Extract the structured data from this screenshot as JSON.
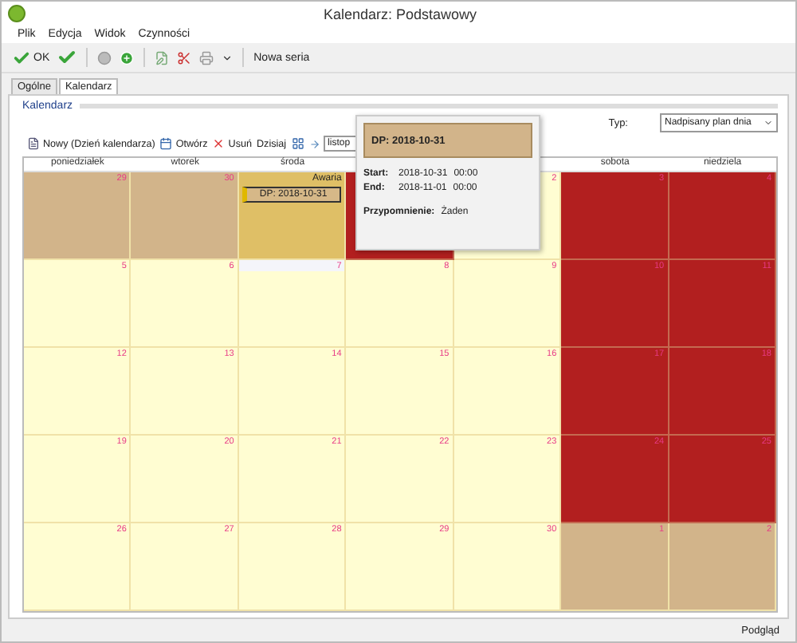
{
  "window": {
    "title": "Kalendarz: Podstawowy"
  },
  "menu": [
    "Plik",
    "Edycja",
    "Widok",
    "Czynności"
  ],
  "toolbar": [
    {
      "kind": "ok",
      "label": "OK"
    },
    {
      "kind": "check"
    },
    {
      "kind": "sep"
    },
    {
      "kind": "stop"
    },
    {
      "kind": "add"
    },
    {
      "kind": "sep"
    },
    {
      "kind": "edit"
    },
    {
      "kind": "tools"
    },
    {
      "kind": "print"
    },
    {
      "kind": "caret"
    },
    {
      "kind": "sep"
    },
    {
      "kind": "text",
      "label": "Nowa seria"
    }
  ],
  "tabs": [
    {
      "label": "Ogólne",
      "selected": false
    },
    {
      "label": "Kalendarz",
      "selected": true
    }
  ],
  "group_title": "Kalendarz",
  "type_label": "Typ:",
  "type_value": "Nadpisany plan dnia",
  "actions": [
    {
      "kind": "new",
      "label": "Nowy (Dzień kalendarza)"
    },
    {
      "kind": "open",
      "label": "Otwórz"
    },
    {
      "kind": "delete",
      "label": "Usuń"
    },
    {
      "kind": "today",
      "label": "Dzisiaj"
    },
    {
      "kind": "view"
    },
    {
      "kind": "arrow"
    }
  ],
  "month_field": "listop",
  "day_headers_left": [
    "poniedziałek",
    "wtorek",
    "środa"
  ],
  "day_headers_right": [
    "sobota",
    "niedziela"
  ],
  "weeks": [
    {
      "days": [
        {
          "n": "29",
          "kind": "past"
        },
        {
          "n": "30",
          "kind": "past"
        },
        {
          "kind": "selected",
          "note": "Awaria",
          "event": "DP: 2018-10-31"
        },
        {
          "kind": "free"
        },
        {
          "n": "2",
          "kind": "work"
        },
        {
          "n": "3",
          "kind": "free"
        },
        {
          "n": "4",
          "kind": "free"
        }
      ]
    },
    {
      "days": [
        {
          "n": "5",
          "kind": "work"
        },
        {
          "n": "6",
          "kind": "work"
        },
        {
          "n": "7",
          "kind": "work",
          "today": true
        },
        {
          "n": "8",
          "kind": "work"
        },
        {
          "n": "9",
          "kind": "work"
        },
        {
          "n": "10",
          "kind": "free"
        },
        {
          "n": "11",
          "kind": "free"
        }
      ]
    },
    {
      "days": [
        {
          "n": "12",
          "kind": "work"
        },
        {
          "n": "13",
          "kind": "work"
        },
        {
          "n": "14",
          "kind": "work"
        },
        {
          "n": "15",
          "kind": "work"
        },
        {
          "n": "16",
          "kind": "work"
        },
        {
          "n": "17",
          "kind": "free"
        },
        {
          "n": "18",
          "kind": "free"
        }
      ]
    },
    {
      "days": [
        {
          "n": "19",
          "kind": "work"
        },
        {
          "n": "20",
          "kind": "work"
        },
        {
          "n": "21",
          "kind": "work"
        },
        {
          "n": "22",
          "kind": "work"
        },
        {
          "n": "23",
          "kind": "work"
        },
        {
          "n": "24",
          "kind": "free"
        },
        {
          "n": "25",
          "kind": "free"
        }
      ]
    },
    {
      "days": [
        {
          "n": "26",
          "kind": "work"
        },
        {
          "n": "27",
          "kind": "work"
        },
        {
          "n": "28",
          "kind": "work"
        },
        {
          "n": "29",
          "kind": "work"
        },
        {
          "n": "30",
          "kind": "work"
        },
        {
          "n": "1",
          "kind": "past"
        },
        {
          "n": "2",
          "kind": "past"
        }
      ]
    }
  ],
  "popup": {
    "title": "DP: 2018-10-31",
    "rows": [
      {
        "label": "Start:",
        "date": "2018-10-31",
        "time": "00:00"
      },
      {
        "label": "End:",
        "date": "2018-11-01",
        "time": "00:00"
      }
    ],
    "reminder_label": "Przypomnienie:",
    "reminder_value": "Żaden"
  },
  "status": "Podgląd"
}
